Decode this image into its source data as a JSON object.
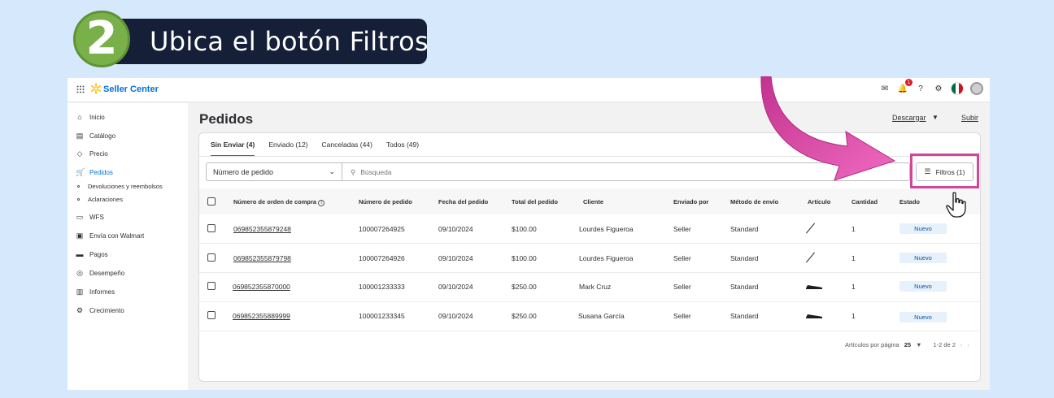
{
  "step": {
    "number": "2",
    "text": "Ubica el botón Filtros"
  },
  "topbar": {
    "brand": "Seller Center",
    "notification_count": "1"
  },
  "sidebar": {
    "items": [
      {
        "label": "Inicio",
        "icon": "home-icon",
        "glyph": "⌂"
      },
      {
        "label": "Catálogo",
        "icon": "catalog-icon",
        "glyph": "▤"
      },
      {
        "label": "Precio",
        "icon": "price-tag-icon",
        "glyph": "◇"
      },
      {
        "label": "Pedidos",
        "icon": "cart-icon",
        "glyph": "🛒"
      },
      {
        "label": "WFS",
        "icon": "wfs-icon",
        "glyph": "▭"
      },
      {
        "label": "Envía con Walmart",
        "icon": "shipping-icon",
        "glyph": "▣"
      },
      {
        "label": "Pagos",
        "icon": "payments-icon",
        "glyph": "▬"
      },
      {
        "label": "Desempeño",
        "icon": "performance-icon",
        "glyph": "◎"
      },
      {
        "label": "Informes",
        "icon": "reports-icon",
        "glyph": "▥"
      },
      {
        "label": "Crecimiento",
        "icon": "growth-icon",
        "glyph": "⚙"
      }
    ],
    "sub_items": [
      "Devoluciones y reembolsos",
      "Aclaraciones"
    ]
  },
  "main": {
    "title": "Pedidos",
    "download_label": "Descargar",
    "upload_label": "Subir",
    "tabs": [
      "Sin Enviar (4)",
      "Enviado (12)",
      "Canceladas (44)",
      "Todos (49)"
    ],
    "select_value": "Número de pedido",
    "search_placeholder": "Búsqueda",
    "filter_label": "Filtros (1)",
    "columns": [
      "Número de orden de compra",
      "Número de pedido",
      "Fecha del pedido",
      "Total del pedido",
      "Cliente",
      "Enviado por",
      "Método de envío",
      "Artículo",
      "Cantidad",
      "Estado"
    ],
    "rows": [
      {
        "po": "069852355879248",
        "order": "100007264925",
        "date": "09/10/2024",
        "total": "$100.00",
        "client": "Lourdes Figueroa",
        "shipped_by": "Seller",
        "method": "Standard",
        "qty": "1",
        "status": "Nuevo"
      },
      {
        "po": "069852355879798",
        "order": "100007264926",
        "date": "09/10/2024",
        "total": "$100.00",
        "client": "Lourdes Figueroa",
        "shipped_by": "Seller",
        "method": "Standard",
        "qty": "1",
        "status": "Nuevo"
      },
      {
        "po": "069852355870000",
        "order": "100001233333",
        "date": "09/10/2024",
        "total": "$250.00",
        "client": "Mark Cruz",
        "shipped_by": "Seller",
        "method": "Standard",
        "qty": "1",
        "status": "Nuevo"
      },
      {
        "po": "069852355889999",
        "order": "100001233345",
        "date": "09/10/2024",
        "total": "$250.00",
        "client": "Susana García",
        "shipped_by": "Seller",
        "method": "Standard",
        "qty": "1",
        "status": "Nuevo"
      }
    ],
    "pager": {
      "label": "Artículos por página",
      "per_page": "25",
      "range": "1-2 de 2"
    }
  },
  "colors": {
    "accent": "#0071dc",
    "highlight": "#d4449b",
    "arrow": "#e455b0",
    "step_green": "#7ab04a",
    "step_dark": "#152038"
  }
}
